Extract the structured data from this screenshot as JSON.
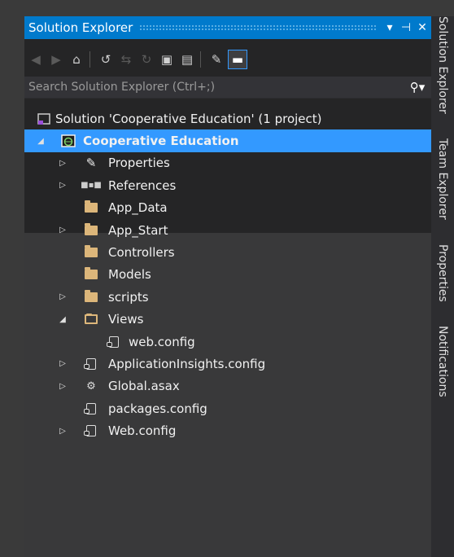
{
  "window": {
    "title": "Solution Explorer",
    "title_buttons": [
      "▾",
      "⊣",
      "✕"
    ]
  },
  "toolbar": {
    "icons": [
      "back-icon",
      "forward-icon",
      "home-icon",
      "history-icon",
      "sync-icon",
      "refresh-icon",
      "collapse-all-icon",
      "show-all-files-icon",
      "properties-wrench-icon",
      "preview-icon"
    ]
  },
  "search": {
    "placeholder": "Search Solution Explorer (Ctrl+;)"
  },
  "tree": {
    "solution": "Solution 'Cooperative Education' (1 project)",
    "project": "Cooperative Education",
    "items": [
      {
        "label": "Properties",
        "expander": "▷"
      },
      {
        "label": "References",
        "expander": "▷"
      },
      {
        "label": "App_Data",
        "expander": ""
      },
      {
        "label": "App_Start",
        "expander": "▷"
      },
      {
        "label": "Controllers",
        "expander": ""
      },
      {
        "label": "Models",
        "expander": ""
      },
      {
        "label": "scripts",
        "expander": "▷"
      },
      {
        "label": "Views",
        "expander": "◢"
      },
      {
        "label": "web.config",
        "expander": ""
      },
      {
        "label": "ApplicationInsights.config",
        "expander": "▷"
      },
      {
        "label": "Global.asax",
        "expander": "▷"
      },
      {
        "label": "packages.config",
        "expander": ""
      },
      {
        "label": "Web.config",
        "expander": "▷"
      }
    ]
  },
  "side_tabs": [
    "Solution Explorer",
    "Team Explorer",
    "Properties",
    "Notifications"
  ],
  "colors": {
    "accent": "#007acc",
    "selection": "#3399ff",
    "folder": "#dcb67a"
  }
}
